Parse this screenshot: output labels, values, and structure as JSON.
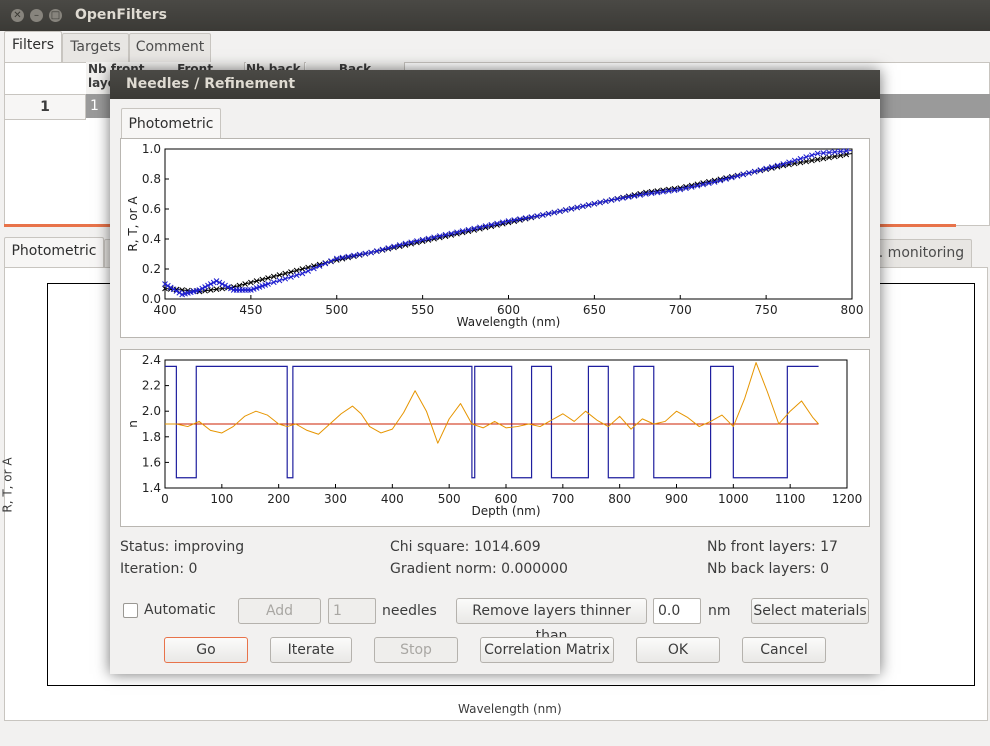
{
  "main": {
    "title": "OpenFilters",
    "tabs": [
      {
        "label": "Filters"
      },
      {
        "label": "Targets"
      },
      {
        "label": "Comment"
      }
    ],
    "table_headers": [
      "Nb front layers",
      "Front",
      "Nb back",
      "Back"
    ],
    "table_row": {
      "index": "1",
      "value": "1"
    },
    "bottom_tabs": [
      {
        "label": "Photometric"
      },
      {
        "label": "p. monitoring"
      }
    ],
    "plot": {
      "ylabel": "R, T, or A",
      "xlabel": "Wavelength (nm)"
    }
  },
  "dialog": {
    "title": "Needles / Refinement",
    "tab": "Photometric",
    "status_label": "Status: improving",
    "iteration_label": "Iteration: 0",
    "chi_square_label": "Chi square: 1014.609",
    "gradient_norm_label": "Gradient norm: 0.000000",
    "front_layers_label": "Nb front layers: 17",
    "back_layers_label": "Nb back layers: 0",
    "automatic_label": "Automatic",
    "add_label": "Add",
    "needles_count": "1",
    "needles_label": "needles",
    "remove_label": "Remove layers thinner than",
    "thickness_value": "0.0",
    "unit_label": "nm",
    "select_materials_label": "Select materials",
    "go_label": "Go",
    "iterate_label": "Iterate",
    "stop_label": "Stop",
    "correlation_label": "Correlation Matrix",
    "ok_label": "OK",
    "cancel_label": "Cancel"
  },
  "chart_data": [
    {
      "type": "scatter",
      "xlabel": "Wavelength (nm)",
      "ylabel": "R, T, or A",
      "xlim": [
        400,
        800
      ],
      "ylim": [
        0.0,
        1.0
      ],
      "xticks": [
        400,
        450,
        500,
        550,
        600,
        650,
        700,
        750,
        800
      ],
      "yticks": [
        0.0,
        0.2,
        0.4,
        0.6,
        0.8,
        1.0
      ],
      "series": [
        {
          "color": "#000000",
          "x": [
            400,
            420,
            440,
            460,
            480,
            500,
            520,
            540,
            560,
            580,
            600,
            620,
            640,
            660,
            680,
            700,
            720,
            740,
            760,
            780,
            800
          ],
          "y": [
            0.07,
            0.05,
            0.08,
            0.14,
            0.2,
            0.26,
            0.31,
            0.36,
            0.41,
            0.46,
            0.51,
            0.56,
            0.61,
            0.66,
            0.71,
            0.74,
            0.79,
            0.84,
            0.89,
            0.93,
            0.97
          ]
        },
        {
          "color": "#1f1fcf",
          "x": [
            400,
            410,
            420,
            430,
            440,
            450,
            460,
            480,
            500,
            520,
            540,
            560,
            580,
            600,
            620,
            640,
            660,
            680,
            700,
            720,
            740,
            760,
            780,
            800
          ],
          "y": [
            0.1,
            0.03,
            0.06,
            0.12,
            0.06,
            0.06,
            0.1,
            0.17,
            0.27,
            0.31,
            0.37,
            0.42,
            0.47,
            0.52,
            0.56,
            0.61,
            0.66,
            0.7,
            0.73,
            0.78,
            0.84,
            0.9,
            0.97,
            0.99
          ]
        }
      ]
    },
    {
      "type": "line",
      "xlabel": "Depth (nm)",
      "ylabel": "n",
      "xlim": [
        0,
        1200
      ],
      "ylim": [
        1.4,
        2.4
      ],
      "xticks": [
        0,
        100,
        200,
        300,
        400,
        500,
        600,
        700,
        800,
        900,
        1000,
        1100,
        1200
      ],
      "yticks": [
        1.4,
        1.6,
        1.8,
        2.0,
        2.2,
        2.4
      ],
      "index_profile": {
        "color": "#1f1f9f",
        "high": 2.35,
        "low": 1.48,
        "layers": [
          [
            0,
            20,
            "high"
          ],
          [
            20,
            55,
            "low"
          ],
          [
            55,
            215,
            "high"
          ],
          [
            215,
            225,
            "low"
          ],
          [
            225,
            540,
            "high"
          ],
          [
            540,
            545,
            "low"
          ],
          [
            545,
            610,
            "high"
          ],
          [
            610,
            645,
            "low"
          ],
          [
            645,
            680,
            "high"
          ],
          [
            680,
            745,
            "low"
          ],
          [
            745,
            780,
            "high"
          ],
          [
            780,
            825,
            "low"
          ],
          [
            825,
            860,
            "high"
          ],
          [
            860,
            960,
            "low"
          ],
          [
            960,
            1000,
            "high"
          ],
          [
            1000,
            1095,
            "low"
          ],
          [
            1095,
            1150,
            "high"
          ]
        ]
      },
      "reference_line": {
        "color": "#cc2200",
        "y": 1.9,
        "x": [
          0,
          1150
        ]
      },
      "needle_function": {
        "color": "#e69500",
        "x": [
          0,
          20,
          40,
          60,
          80,
          100,
          120,
          140,
          160,
          180,
          200,
          215,
          230,
          250,
          270,
          290,
          310,
          330,
          345,
          360,
          380,
          400,
          420,
          440,
          460,
          480,
          500,
          520,
          540,
          560,
          580,
          600,
          620,
          640,
          660,
          680,
          700,
          720,
          740,
          760,
          780,
          800,
          820,
          840,
          860,
          880,
          900,
          920,
          940,
          960,
          980,
          1000,
          1020,
          1040,
          1060,
          1080,
          1100,
          1120,
          1140,
          1150
        ],
        "y": [
          1.9,
          1.9,
          1.88,
          1.92,
          1.85,
          1.83,
          1.88,
          1.96,
          2.0,
          1.97,
          1.9,
          1.88,
          1.9,
          1.85,
          1.82,
          1.9,
          1.98,
          2.04,
          1.98,
          1.88,
          1.83,
          1.86,
          1.99,
          2.16,
          2.0,
          1.75,
          1.94,
          2.06,
          1.9,
          1.87,
          1.92,
          1.87,
          1.88,
          1.9,
          1.88,
          1.93,
          1.98,
          1.92,
          2.0,
          1.93,
          1.88,
          1.96,
          1.86,
          1.94,
          1.9,
          1.92,
          2.0,
          1.95,
          1.88,
          1.92,
          1.97,
          1.88,
          2.1,
          2.38,
          2.15,
          1.9,
          2.0,
          2.08,
          1.95,
          1.9
        ]
      }
    }
  ]
}
